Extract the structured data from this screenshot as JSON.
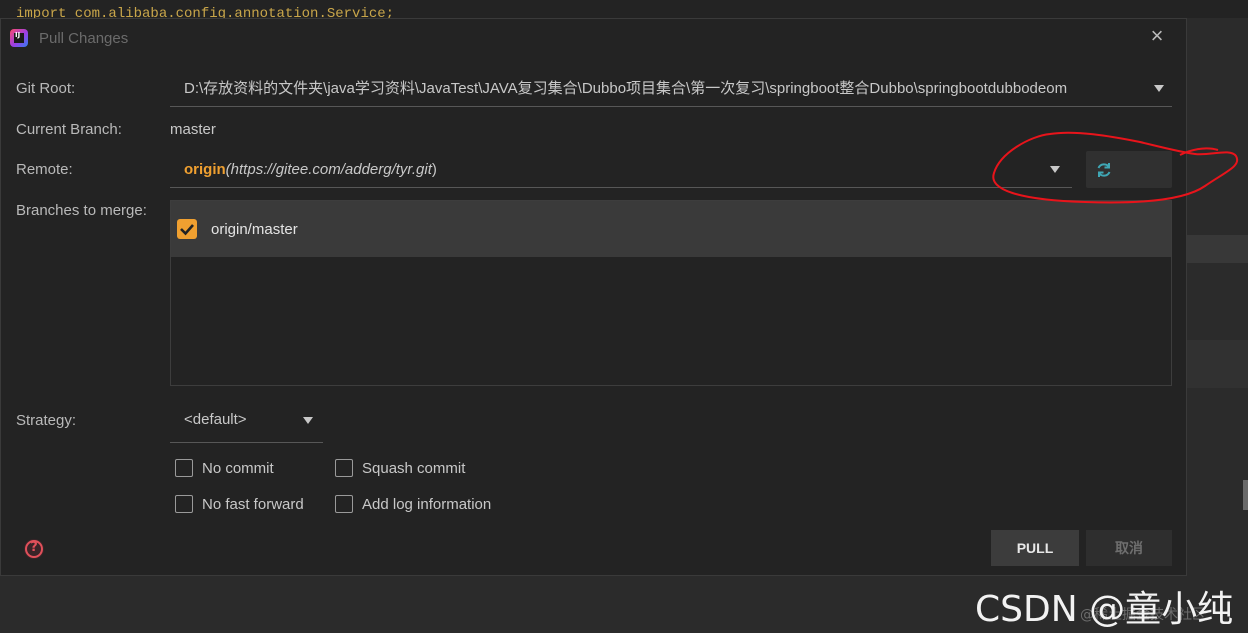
{
  "editor": {
    "code_fragment": "import com.alibaba.config.annotation.Service;"
  },
  "dialog": {
    "title": "Pull Changes",
    "close_glyph": "×"
  },
  "form": {
    "git_root_label": "Git Root:",
    "git_root_value": "D:\\存放资料的文件夹\\java学习资料\\JavaTest\\JAVA复习集合\\Dubbo项目集合\\第一次复习\\springboot整合Dubbo\\springbootdubbodeom",
    "current_branch_label": "Current Branch:",
    "current_branch_value": "master",
    "remote_label": "Remote:",
    "remote_name": "origin",
    "remote_url_open": "(",
    "remote_url": "https://gitee.com/adderg/tyr.git",
    "remote_url_close": ")",
    "branches_label": "Branches to merge:",
    "branches": [
      {
        "name": "origin/master",
        "checked": true
      }
    ],
    "strategy_label": "Strategy:",
    "strategy_value": "<default>"
  },
  "options": {
    "no_commit": "No commit",
    "squash_commit": "Squash commit",
    "no_fast_forward": "No fast forward",
    "add_log_information": "Add log information"
  },
  "buttons": {
    "pull": "PULL",
    "cancel": "取消",
    "help": "?"
  },
  "watermark": {
    "main": "CSDN @童小纯",
    "sub": "@稀土掘金技术社区"
  },
  "colors": {
    "accent_orange": "#f0a030",
    "refresh_teal": "#3fa7b5",
    "annotation_red": "#e8141b",
    "help_red": "#e0505a"
  }
}
